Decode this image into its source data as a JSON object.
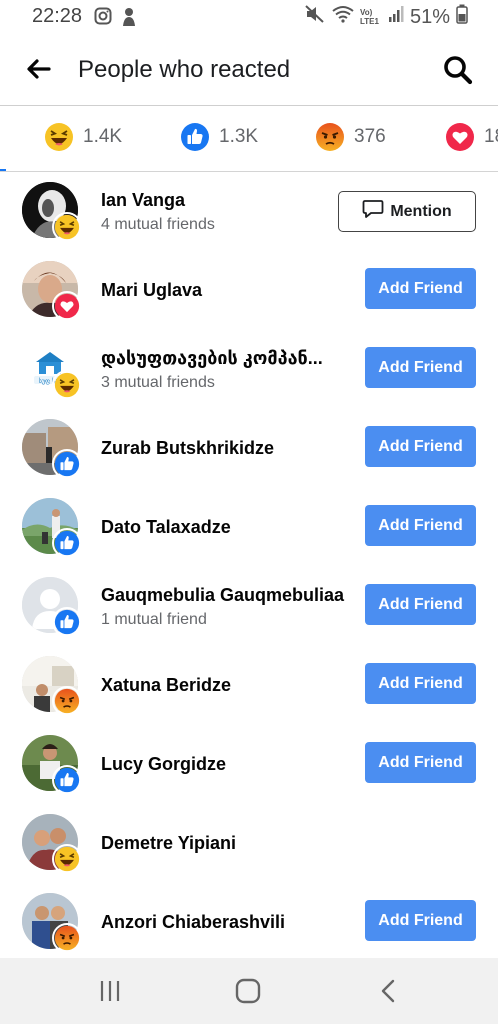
{
  "status_bar": {
    "time": "22:28",
    "battery": "51%",
    "network_label": "Vo) LTE1"
  },
  "header": {
    "title": "People who reacted"
  },
  "tabs": [
    {
      "reaction": "haha",
      "count": "1.4K"
    },
    {
      "reaction": "like",
      "count": "1.3K"
    },
    {
      "reaction": "angry",
      "count": "376"
    },
    {
      "reaction": "love",
      "count": "18"
    }
  ],
  "colors": {
    "accent": "#1877f2",
    "button": "#4b8ef1",
    "like": "#1877f2",
    "love": "#f0284a",
    "haha_angry_yellow": "#f7b125",
    "angry_red": "#e9710f"
  },
  "people": [
    {
      "name": "Ian Vanga",
      "mutual": "4 mutual friends",
      "reaction": "haha",
      "action": "Mention"
    },
    {
      "name": "Mari Uglava",
      "mutual": "",
      "reaction": "love",
      "action": "Add Friend"
    },
    {
      "name": "დასუფთავების კომპან...",
      "mutual": "3 mutual friends",
      "reaction": "haha",
      "action": "Add Friend"
    },
    {
      "name": "Zurab Butskhrikidze",
      "mutual": "",
      "reaction": "like",
      "action": "Add Friend"
    },
    {
      "name": "Dato Talaxadze",
      "mutual": "",
      "reaction": "like",
      "action": "Add Friend"
    },
    {
      "name": "Gauqmebulia Gauqmebuliaa",
      "mutual": "1 mutual friend",
      "reaction": "like",
      "action": "Add Friend"
    },
    {
      "name": "Xatuna Beridze",
      "mutual": "",
      "reaction": "angry",
      "action": "Add Friend"
    },
    {
      "name": "Lucy Gorgidze",
      "mutual": "",
      "reaction": "like",
      "action": "Add Friend"
    },
    {
      "name": "Demetre Yipiani",
      "mutual": "",
      "reaction": "haha",
      "action": ""
    },
    {
      "name": "Anzori Chiaberashvili",
      "mutual": "",
      "reaction": "angry",
      "action": "Add Friend"
    }
  ]
}
